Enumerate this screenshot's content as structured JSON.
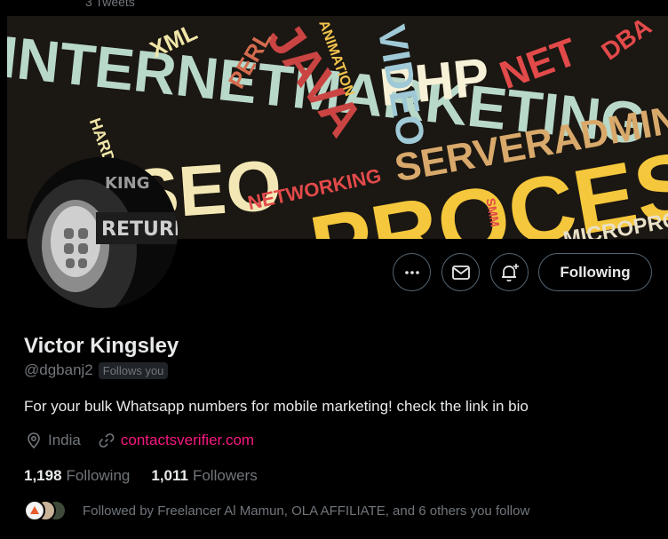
{
  "header": {
    "tweets_count": "3 Tweets"
  },
  "banner": {
    "words": [
      "INTERNETMARKETING",
      "SEO",
      "PHP",
      "SERVERADMINISTRAT",
      "PROCESSO",
      "NETWORKING",
      "JAVA",
      "XML",
      "PERL",
      "VIDEO",
      "ANIMATION",
      "HARDWARE",
      "NET",
      "DBA",
      "MICROPROCE",
      "SMM"
    ]
  },
  "avatar": {
    "text_top": "KING",
    "text_badge": "RETURN"
  },
  "actions": {
    "more_icon": "more-icon",
    "message_icon": "envelope-icon",
    "notify_icon": "bell-plus-icon",
    "following_label": "Following"
  },
  "profile": {
    "name": "Victor Kingsley",
    "handle": "@dgbanj2",
    "follows_you": "Follows you",
    "bio": "For your bulk Whatsapp numbers for mobile marketing! check the link in bio",
    "location": "India",
    "url": "contactsverifier.com",
    "following_count": "1,198",
    "following_label": "Following",
    "followers_count": "1,011",
    "followers_label": "Followers",
    "followed_by": "Followed by Freelancer Al Mamun, OLA AFFILIATE, and 6 others you follow"
  },
  "colors": {
    "background": "#000000",
    "text": "#e7e9ea",
    "muted": "#71767b",
    "link": "#f91880",
    "border": "#536471"
  }
}
